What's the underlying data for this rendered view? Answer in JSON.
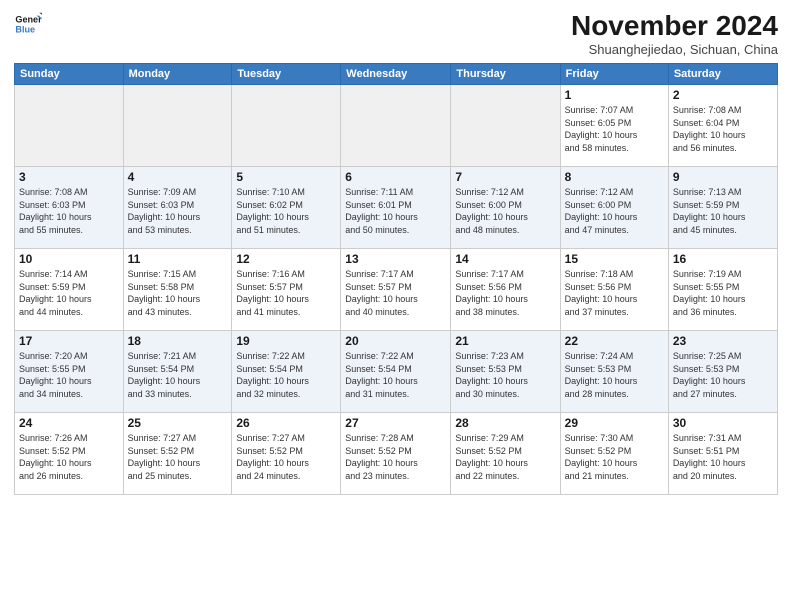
{
  "app": {
    "name": "GeneralBlue",
    "logo_text_line1": "General",
    "logo_text_line2": "Blue"
  },
  "header": {
    "month": "November 2024",
    "location": "Shuanghejiedao, Sichuan, China"
  },
  "weekdays": [
    "Sunday",
    "Monday",
    "Tuesday",
    "Wednesday",
    "Thursday",
    "Friday",
    "Saturday"
  ],
  "weeks": [
    {
      "days": [
        {
          "num": "",
          "info": ""
        },
        {
          "num": "",
          "info": ""
        },
        {
          "num": "",
          "info": ""
        },
        {
          "num": "",
          "info": ""
        },
        {
          "num": "",
          "info": ""
        },
        {
          "num": "1",
          "info": "Sunrise: 7:07 AM\nSunset: 6:05 PM\nDaylight: 10 hours\nand 58 minutes."
        },
        {
          "num": "2",
          "info": "Sunrise: 7:08 AM\nSunset: 6:04 PM\nDaylight: 10 hours\nand 56 minutes."
        }
      ]
    },
    {
      "days": [
        {
          "num": "3",
          "info": "Sunrise: 7:08 AM\nSunset: 6:03 PM\nDaylight: 10 hours\nand 55 minutes."
        },
        {
          "num": "4",
          "info": "Sunrise: 7:09 AM\nSunset: 6:03 PM\nDaylight: 10 hours\nand 53 minutes."
        },
        {
          "num": "5",
          "info": "Sunrise: 7:10 AM\nSunset: 6:02 PM\nDaylight: 10 hours\nand 51 minutes."
        },
        {
          "num": "6",
          "info": "Sunrise: 7:11 AM\nSunset: 6:01 PM\nDaylight: 10 hours\nand 50 minutes."
        },
        {
          "num": "7",
          "info": "Sunrise: 7:12 AM\nSunset: 6:00 PM\nDaylight: 10 hours\nand 48 minutes."
        },
        {
          "num": "8",
          "info": "Sunrise: 7:12 AM\nSunset: 6:00 PM\nDaylight: 10 hours\nand 47 minutes."
        },
        {
          "num": "9",
          "info": "Sunrise: 7:13 AM\nSunset: 5:59 PM\nDaylight: 10 hours\nand 45 minutes."
        }
      ]
    },
    {
      "days": [
        {
          "num": "10",
          "info": "Sunrise: 7:14 AM\nSunset: 5:59 PM\nDaylight: 10 hours\nand 44 minutes."
        },
        {
          "num": "11",
          "info": "Sunrise: 7:15 AM\nSunset: 5:58 PM\nDaylight: 10 hours\nand 43 minutes."
        },
        {
          "num": "12",
          "info": "Sunrise: 7:16 AM\nSunset: 5:57 PM\nDaylight: 10 hours\nand 41 minutes."
        },
        {
          "num": "13",
          "info": "Sunrise: 7:17 AM\nSunset: 5:57 PM\nDaylight: 10 hours\nand 40 minutes."
        },
        {
          "num": "14",
          "info": "Sunrise: 7:17 AM\nSunset: 5:56 PM\nDaylight: 10 hours\nand 38 minutes."
        },
        {
          "num": "15",
          "info": "Sunrise: 7:18 AM\nSunset: 5:56 PM\nDaylight: 10 hours\nand 37 minutes."
        },
        {
          "num": "16",
          "info": "Sunrise: 7:19 AM\nSunset: 5:55 PM\nDaylight: 10 hours\nand 36 minutes."
        }
      ]
    },
    {
      "days": [
        {
          "num": "17",
          "info": "Sunrise: 7:20 AM\nSunset: 5:55 PM\nDaylight: 10 hours\nand 34 minutes."
        },
        {
          "num": "18",
          "info": "Sunrise: 7:21 AM\nSunset: 5:54 PM\nDaylight: 10 hours\nand 33 minutes."
        },
        {
          "num": "19",
          "info": "Sunrise: 7:22 AM\nSunset: 5:54 PM\nDaylight: 10 hours\nand 32 minutes."
        },
        {
          "num": "20",
          "info": "Sunrise: 7:22 AM\nSunset: 5:54 PM\nDaylight: 10 hours\nand 31 minutes."
        },
        {
          "num": "21",
          "info": "Sunrise: 7:23 AM\nSunset: 5:53 PM\nDaylight: 10 hours\nand 30 minutes."
        },
        {
          "num": "22",
          "info": "Sunrise: 7:24 AM\nSunset: 5:53 PM\nDaylight: 10 hours\nand 28 minutes."
        },
        {
          "num": "23",
          "info": "Sunrise: 7:25 AM\nSunset: 5:53 PM\nDaylight: 10 hours\nand 27 minutes."
        }
      ]
    },
    {
      "days": [
        {
          "num": "24",
          "info": "Sunrise: 7:26 AM\nSunset: 5:52 PM\nDaylight: 10 hours\nand 26 minutes."
        },
        {
          "num": "25",
          "info": "Sunrise: 7:27 AM\nSunset: 5:52 PM\nDaylight: 10 hours\nand 25 minutes."
        },
        {
          "num": "26",
          "info": "Sunrise: 7:27 AM\nSunset: 5:52 PM\nDaylight: 10 hours\nand 24 minutes."
        },
        {
          "num": "27",
          "info": "Sunrise: 7:28 AM\nSunset: 5:52 PM\nDaylight: 10 hours\nand 23 minutes."
        },
        {
          "num": "28",
          "info": "Sunrise: 7:29 AM\nSunset: 5:52 PM\nDaylight: 10 hours\nand 22 minutes."
        },
        {
          "num": "29",
          "info": "Sunrise: 7:30 AM\nSunset: 5:52 PM\nDaylight: 10 hours\nand 21 minutes."
        },
        {
          "num": "30",
          "info": "Sunrise: 7:31 AM\nSunset: 5:51 PM\nDaylight: 10 hours\nand 20 minutes."
        }
      ]
    }
  ]
}
